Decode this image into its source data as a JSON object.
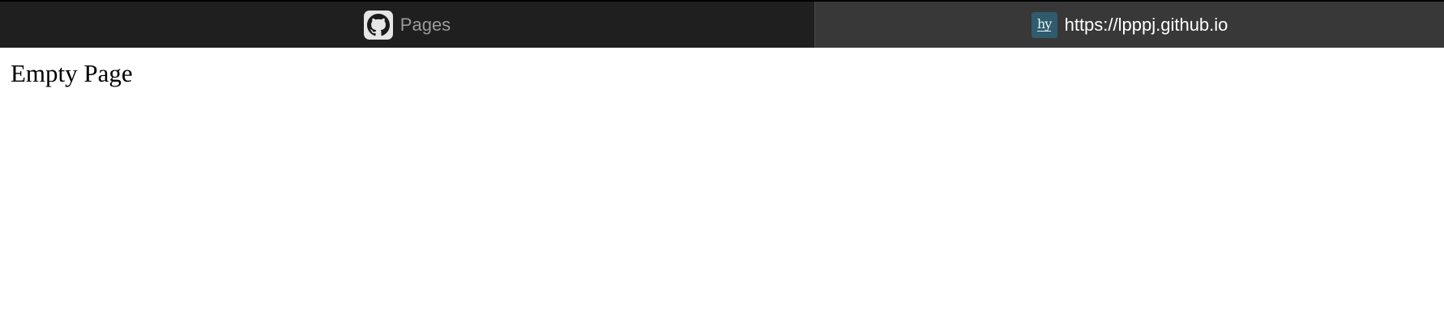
{
  "tabs": [
    {
      "label": "Pages",
      "icon": "github-icon",
      "active": false
    },
    {
      "label": "https://lpppj.github.io",
      "icon": "hy-site-icon",
      "icon_text": "hy",
      "active": true
    }
  ],
  "page": {
    "heading": "Empty Page"
  },
  "colors": {
    "tabbar_bg": "#1f1f1f",
    "active_tab_bg": "#383838",
    "favicon_bg": "#2f5b6c"
  }
}
